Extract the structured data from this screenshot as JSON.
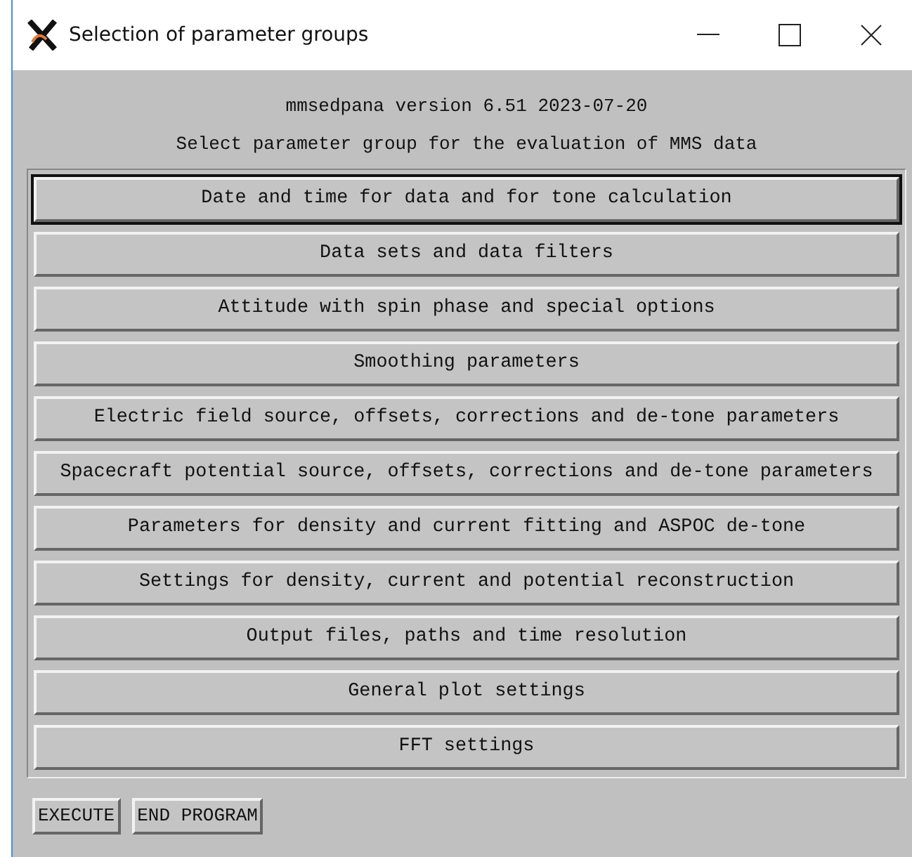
{
  "window": {
    "title": "Selection of parameter groups"
  },
  "header": {
    "version": "mmsedpana version 6.51 2023-07-20",
    "prompt": "Select parameter group for the evaluation of MMS data"
  },
  "groups": [
    {
      "label": "Date and time for data and for tone calculation",
      "focused": true
    },
    {
      "label": "Data sets and data filters",
      "focused": false
    },
    {
      "label": "Attitude with spin phase and special options",
      "focused": false
    },
    {
      "label": "Smoothing parameters",
      "focused": false
    },
    {
      "label": "Electric field source, offsets, corrections and de-tone parameters",
      "focused": false
    },
    {
      "label": "Spacecraft potential source, offsets, corrections and de-tone parameters",
      "focused": false
    },
    {
      "label": "Parameters for density and current fitting and ASPOC de-tone",
      "focused": false
    },
    {
      "label": "Settings for density, current and potential reconstruction",
      "focused": false
    },
    {
      "label": "Output files, paths and time resolution",
      "focused": false
    },
    {
      "label": "General plot settings",
      "focused": false
    },
    {
      "label": "FFT settings",
      "focused": false
    }
  ],
  "buttons": [
    "EXECUTE",
    "END PROGRAM"
  ]
}
